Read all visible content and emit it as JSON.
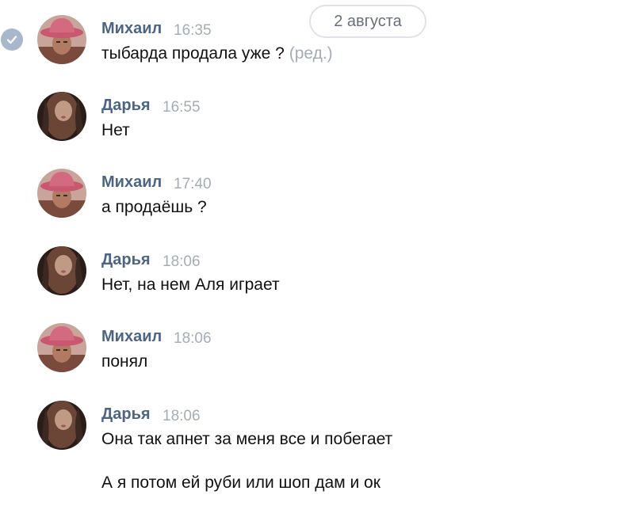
{
  "date_divider": "2 августа",
  "messages": [
    {
      "author": "Михаил",
      "time": "16:35",
      "text": "тыбарда продала уже ?",
      "edited": "(ред.)"
    },
    {
      "author": "Дарья",
      "time": "16:55",
      "text": "Нет"
    },
    {
      "author": "Михаил",
      "time": "17:40",
      "text": "а продаёшь ?"
    },
    {
      "author": "Дарья",
      "time": "18:06",
      "text": "Нет, на нем Аля играет"
    },
    {
      "author": "Михаил",
      "time": "18:06",
      "text": "понял"
    },
    {
      "author": "Дарья",
      "time": "18:06",
      "text": "Она так апнет за меня все и побегает",
      "text2": "А я потом ей руби или шоп дам и ок"
    }
  ],
  "colors": {
    "author_name": "#4d6585",
    "muted": "#a4acb5",
    "read_badge": "#a8b7cb"
  },
  "icons": {
    "read_status": "check-circle-icon"
  }
}
